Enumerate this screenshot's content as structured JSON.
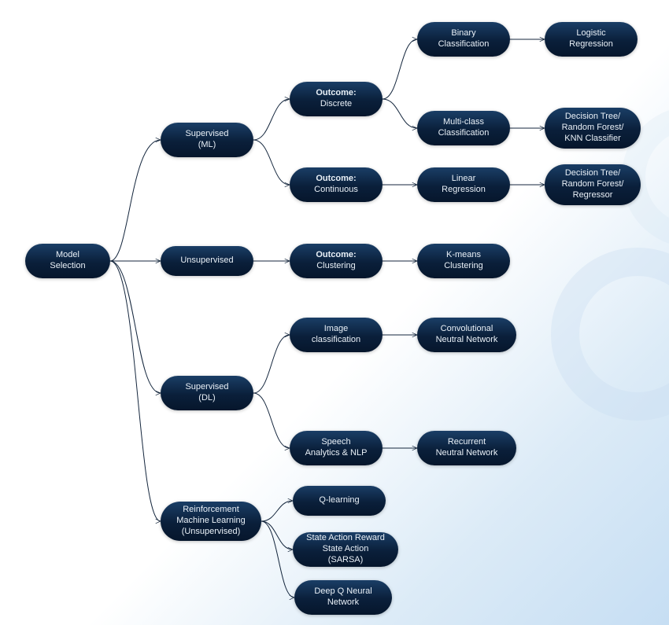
{
  "diagram": {
    "root": "Model\nSelection",
    "supervised_ml": "Supervised\n(ML)",
    "unsupervised": "Unsupervised",
    "supervised_dl": "Supervised\n(DL)",
    "reinforcement": "Reinforcement\nMachine Learning\n(Unsupervised)",
    "outcome_discrete_label": "Outcome:",
    "outcome_discrete_value": "Discrete",
    "outcome_continuous_label": "Outcome:",
    "outcome_continuous_value": "Continuous",
    "outcome_clustering_label": "Outcome:",
    "outcome_clustering_value": "Clustering",
    "binary_classification": "Binary\nClassification",
    "multiclass_classification": "Multi-class\nClassification",
    "linear_regression": "Linear\nRegression",
    "kmeans": "K-means\nClustering",
    "image_classification": "Image\nclassification",
    "speech_nlp": "Speech\nAnalytics & NLP",
    "q_learning": "Q-learning",
    "sarsa": "State Action Reward\nState Action (SARSA)",
    "deep_q": "Deep Q Neural\nNetwork",
    "logistic_regression": "Logistic\nRegression",
    "dt_rf_knn": "Decision Tree/\nRandom Forest/\nKNN Classifier",
    "dt_rf_regressor": "Decision Tree/\nRandom Forest/\nRegressor",
    "cnn": "Convolutional\nNeutral Network",
    "rnn": "Recurrent\nNeutral Network"
  },
  "colors": {
    "node_gradient_top": "#1a3e66",
    "node_gradient_bottom": "#06162c",
    "arrow": "#14263d"
  }
}
